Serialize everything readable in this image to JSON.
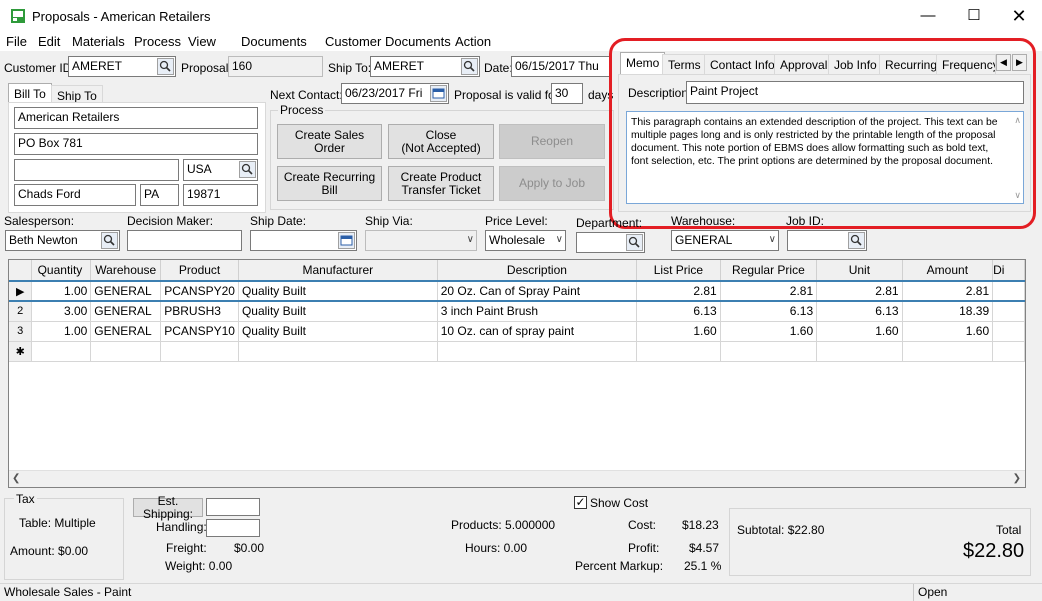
{
  "window": {
    "title": "Proposals - American Retailers"
  },
  "menu": [
    "File",
    "Edit",
    "Materials",
    "Process",
    "View",
    "Documents",
    "Customer Documents",
    "Action"
  ],
  "header": {
    "customer_id_label": "Customer ID:",
    "customer_id": "AMERET",
    "proposal_label": "Proposal:",
    "proposal": "160",
    "ship_to_label": "Ship To:",
    "ship_to": "AMERET",
    "date_label": "Date:",
    "date": "06/15/2017 Thu",
    "next_contact_label": "Next Contact:",
    "next_contact": "06/23/2017 Fri",
    "valid_for_label": "Proposal is valid for",
    "valid_for": "30",
    "days_label": "days"
  },
  "address_tabs": [
    "Bill To",
    "Ship To"
  ],
  "address": {
    "name": "American Retailers",
    "line1": "PO Box 781",
    "line2": "",
    "country": "USA",
    "city": "Chads Ford",
    "state": "PA",
    "zip": "19871"
  },
  "process": {
    "title": "Process",
    "create_sales_order": "Create Sales Order",
    "close_line1": "Close",
    "close_line2": "(Not Accepted)",
    "reopen": "Reopen",
    "create_recurring_bill": "Create Recurring Bill",
    "transfer_line1": "Create Product",
    "transfer_line2": "Transfer Ticket",
    "apply_to_job": "Apply to Job"
  },
  "memo_tabs": [
    "Memo",
    "Terms",
    "Contact Info",
    "Approval",
    "Job Info",
    "Recurring",
    "Frequency"
  ],
  "memo": {
    "description_label": "Description:",
    "description": "Paint Project",
    "text": "This paragraph contains an extended description of the project. This text can be multiple pages long and is only restricted by the printable length of the proposal document. This note portion of EBMS does allow formatting such as bold text, font selection, etc. The print options are determined by the proposal document."
  },
  "fields": {
    "salesperson_label": "Salesperson:",
    "salesperson": "Beth Newton",
    "decision_maker_label": "Decision Maker:",
    "decision_maker": "",
    "ship_date_label": "Ship Date:",
    "ship_date": "",
    "ship_via_label": "Ship Via:",
    "ship_via": "",
    "price_level_label": "Price Level:",
    "price_level": "Wholesale",
    "department_label": "Department:",
    "department": "",
    "warehouse_label": "Warehouse:",
    "warehouse": "GENERAL",
    "job_id_label": "Job ID:",
    "job_id": ""
  },
  "grid": {
    "columns": [
      "",
      "Quantity",
      "Warehouse",
      "Product",
      "Manufacturer",
      "Description",
      "List Price",
      "Regular Price",
      "Unit",
      "Amount",
      "Di"
    ],
    "rows": [
      {
        "rh": "▶",
        "qty": "1.00",
        "wh": "GENERAL",
        "product": "PCANSPY20",
        "mfr": "Quality Built",
        "desc": "20 Oz. Can of Spray Paint",
        "list": "2.81",
        "regular": "2.81",
        "unit": "2.81",
        "amount": "2.81"
      },
      {
        "rh": "2",
        "qty": "3.00",
        "wh": "GENERAL",
        "product": "PBRUSH3",
        "mfr": "Quality Built",
        "desc": "3 inch Paint Brush",
        "list": "6.13",
        "regular": "6.13",
        "unit": "6.13",
        "amount": "18.39"
      },
      {
        "rh": "3",
        "qty": "1.00",
        "wh": "GENERAL",
        "product": "PCANSPY10",
        "mfr": "Quality Built",
        "desc": "10 Oz. can of spray paint",
        "list": "1.60",
        "regular": "1.60",
        "unit": "1.60",
        "amount": "1.60"
      },
      {
        "rh": "✱",
        "qty": "",
        "wh": "",
        "product": "",
        "mfr": "",
        "desc": "",
        "list": "",
        "regular": "",
        "unit": "",
        "amount": ""
      }
    ]
  },
  "tax": {
    "title": "Tax",
    "table": "Table: Multiple",
    "amount": "Amount: $0.00"
  },
  "totals": {
    "est_shipping": "Est. Shipping:",
    "handling": "Handling:",
    "freight_label": "Freight:",
    "freight": "$0.00",
    "weight": "Weight: 0.00",
    "products": "Products: 5.000000",
    "hours": "Hours: 0.00",
    "show_cost": "Show Cost",
    "cost_label": "Cost:",
    "cost": "$18.23",
    "profit_label": "Profit:",
    "profit": "$4.57",
    "markup_label": "Percent Markup:",
    "markup": "25.1 %",
    "subtotal": "Subtotal: $22.80",
    "total_label": "Total",
    "total": "$22.80"
  },
  "status": {
    "left": "Wholesale Sales - Paint",
    "right": "Open"
  },
  "colors": {
    "highlight": "#e31e24",
    "selected_row_line": "#3c7fb1"
  }
}
